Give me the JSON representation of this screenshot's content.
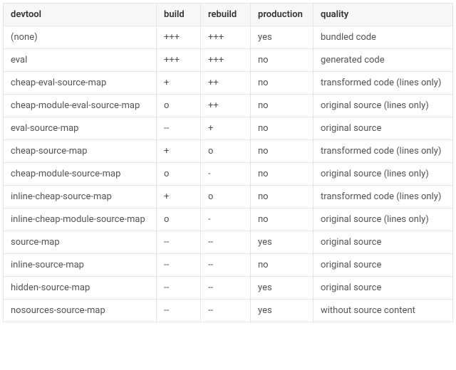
{
  "table": {
    "headers": {
      "devtool": "devtool",
      "build": "build",
      "rebuild": "rebuild",
      "production": "production",
      "quality": "quality"
    },
    "rows": [
      {
        "devtool": "(none)",
        "build": "+++",
        "rebuild": "+++",
        "production": "yes",
        "quality": "bundled code"
      },
      {
        "devtool": "eval",
        "build": "+++",
        "rebuild": "+++",
        "production": "no",
        "quality": "generated code"
      },
      {
        "devtool": "cheap-eval-source-map",
        "build": "+",
        "rebuild": "++",
        "production": "no",
        "quality": "transformed code (lines only)"
      },
      {
        "devtool": "cheap-module-eval-source-map",
        "build": "o",
        "rebuild": "++",
        "production": "no",
        "quality": "original source (lines only)"
      },
      {
        "devtool": "eval-source-map",
        "build": "--",
        "rebuild": "+",
        "production": "no",
        "quality": "original source"
      },
      {
        "devtool": "cheap-source-map",
        "build": "+",
        "rebuild": "o",
        "production": "no",
        "quality": "transformed code (lines only)"
      },
      {
        "devtool": "cheap-module-source-map",
        "build": "o",
        "rebuild": "-",
        "production": "no",
        "quality": "original source (lines only)"
      },
      {
        "devtool": "inline-cheap-source-map",
        "build": "+",
        "rebuild": "o",
        "production": "no",
        "quality": "transformed code (lines only)"
      },
      {
        "devtool": "inline-cheap-module-source-map",
        "build": "o",
        "rebuild": "-",
        "production": "no",
        "quality": "original source (lines only)"
      },
      {
        "devtool": "source-map",
        "build": "--",
        "rebuild": "--",
        "production": "yes",
        "quality": "original source"
      },
      {
        "devtool": "inline-source-map",
        "build": "--",
        "rebuild": "--",
        "production": "no",
        "quality": "original source"
      },
      {
        "devtool": "hidden-source-map",
        "build": "--",
        "rebuild": "--",
        "production": "yes",
        "quality": "original source"
      },
      {
        "devtool": "nosources-source-map",
        "build": "--",
        "rebuild": "--",
        "production": "yes",
        "quality": "without source content"
      }
    ]
  }
}
